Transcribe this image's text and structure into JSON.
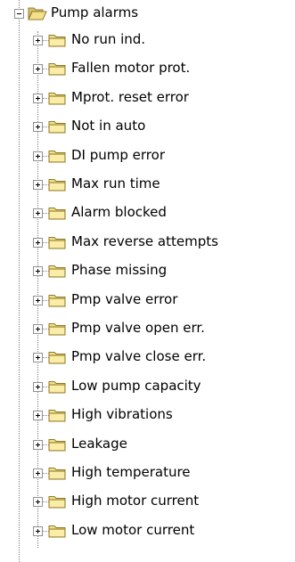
{
  "tree": {
    "root": {
      "label": "Pump alarms",
      "icon": "folder-open-icon",
      "expanded": true
    },
    "children": [
      {
        "label": "No run ind.",
        "icon": "folder-icon"
      },
      {
        "label": "Fallen motor prot.",
        "icon": "folder-icon"
      },
      {
        "label": "Mprot. reset error",
        "icon": "folder-icon"
      },
      {
        "label": "Not in auto",
        "icon": "folder-icon"
      },
      {
        "label": "DI pump error",
        "icon": "folder-icon"
      },
      {
        "label": "Max run time",
        "icon": "folder-icon"
      },
      {
        "label": "Alarm blocked",
        "icon": "folder-icon"
      },
      {
        "label": "Max reverse attempts",
        "icon": "folder-icon"
      },
      {
        "label": "Phase missing",
        "icon": "folder-icon"
      },
      {
        "label": "Pmp valve error",
        "icon": "folder-icon"
      },
      {
        "label": "Pmp valve open err.",
        "icon": "folder-icon"
      },
      {
        "label": "Pmp valve close err.",
        "icon": "folder-icon"
      },
      {
        "label": "Low pump capacity",
        "icon": "folder-icon"
      },
      {
        "label": "High vibrations",
        "icon": "folder-icon"
      },
      {
        "label": "Leakage",
        "icon": "folder-icon"
      },
      {
        "label": "High temperature",
        "icon": "folder-icon"
      },
      {
        "label": "High motor current",
        "icon": "folder-icon"
      },
      {
        "label": "Low motor current",
        "icon": "folder-icon"
      }
    ]
  },
  "colors": {
    "folder_fill": "#f5e08a",
    "folder_edge": "#8f7a2a",
    "guide_line": "#808080",
    "expander_border": "#919191"
  }
}
